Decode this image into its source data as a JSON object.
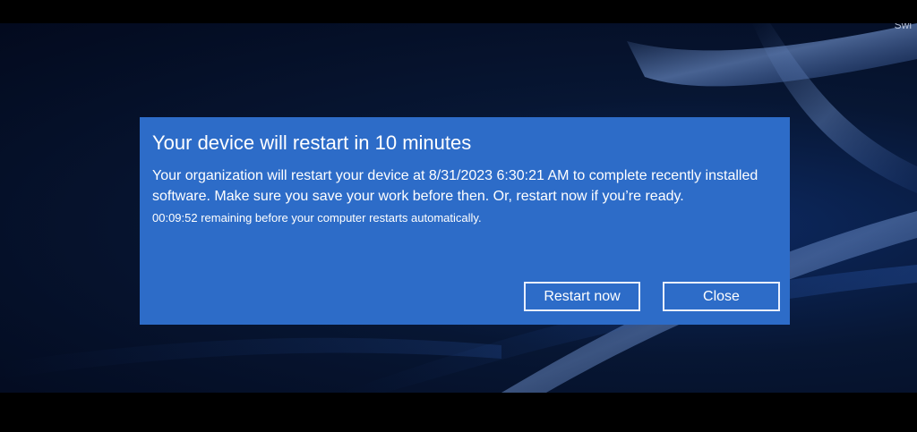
{
  "desktop": {
    "corner_text": "Swi"
  },
  "dialog": {
    "title": "Your device will restart in 10 minutes",
    "body": "Your organization will restart your device at 8/31/2023 6:30:21 AM to complete recently installed software. Make sure you save your work before then. Or, restart now if you’re ready.",
    "countdown": "00:09:52 remaining before your computer restarts automatically.",
    "restart_now_label": "Restart now",
    "close_label": "Close"
  },
  "colors": {
    "dialog_background": "#2d6cc8",
    "desktop_background": "#071633",
    "button_border": "#e8efff",
    "text": "#ffffff"
  }
}
